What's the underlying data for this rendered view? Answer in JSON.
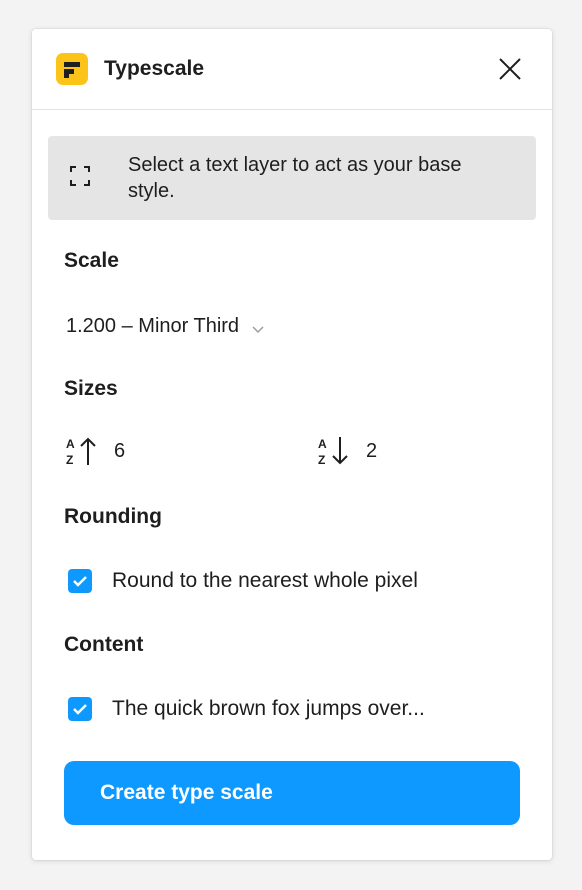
{
  "app": {
    "title": "Typescale",
    "brand_color": "#fcc419"
  },
  "notice": {
    "icon": "selection-frame-icon",
    "text": "Select a text layer to act as your base style."
  },
  "scale": {
    "heading": "Scale",
    "selected": "1.200 – Minor Third"
  },
  "sizes": {
    "heading": "Sizes",
    "up": {
      "icon": "sort-up-icon",
      "value": "6"
    },
    "down": {
      "icon": "sort-down-icon",
      "value": "2"
    }
  },
  "rounding": {
    "heading": "Rounding",
    "label": "Round to the nearest whole pixel",
    "checked": true
  },
  "content": {
    "heading": "Content",
    "label": "The quick brown fox jumps over...",
    "checked": true
  },
  "actions": {
    "create_label": "Create type scale",
    "accent_color": "#0d99ff"
  }
}
